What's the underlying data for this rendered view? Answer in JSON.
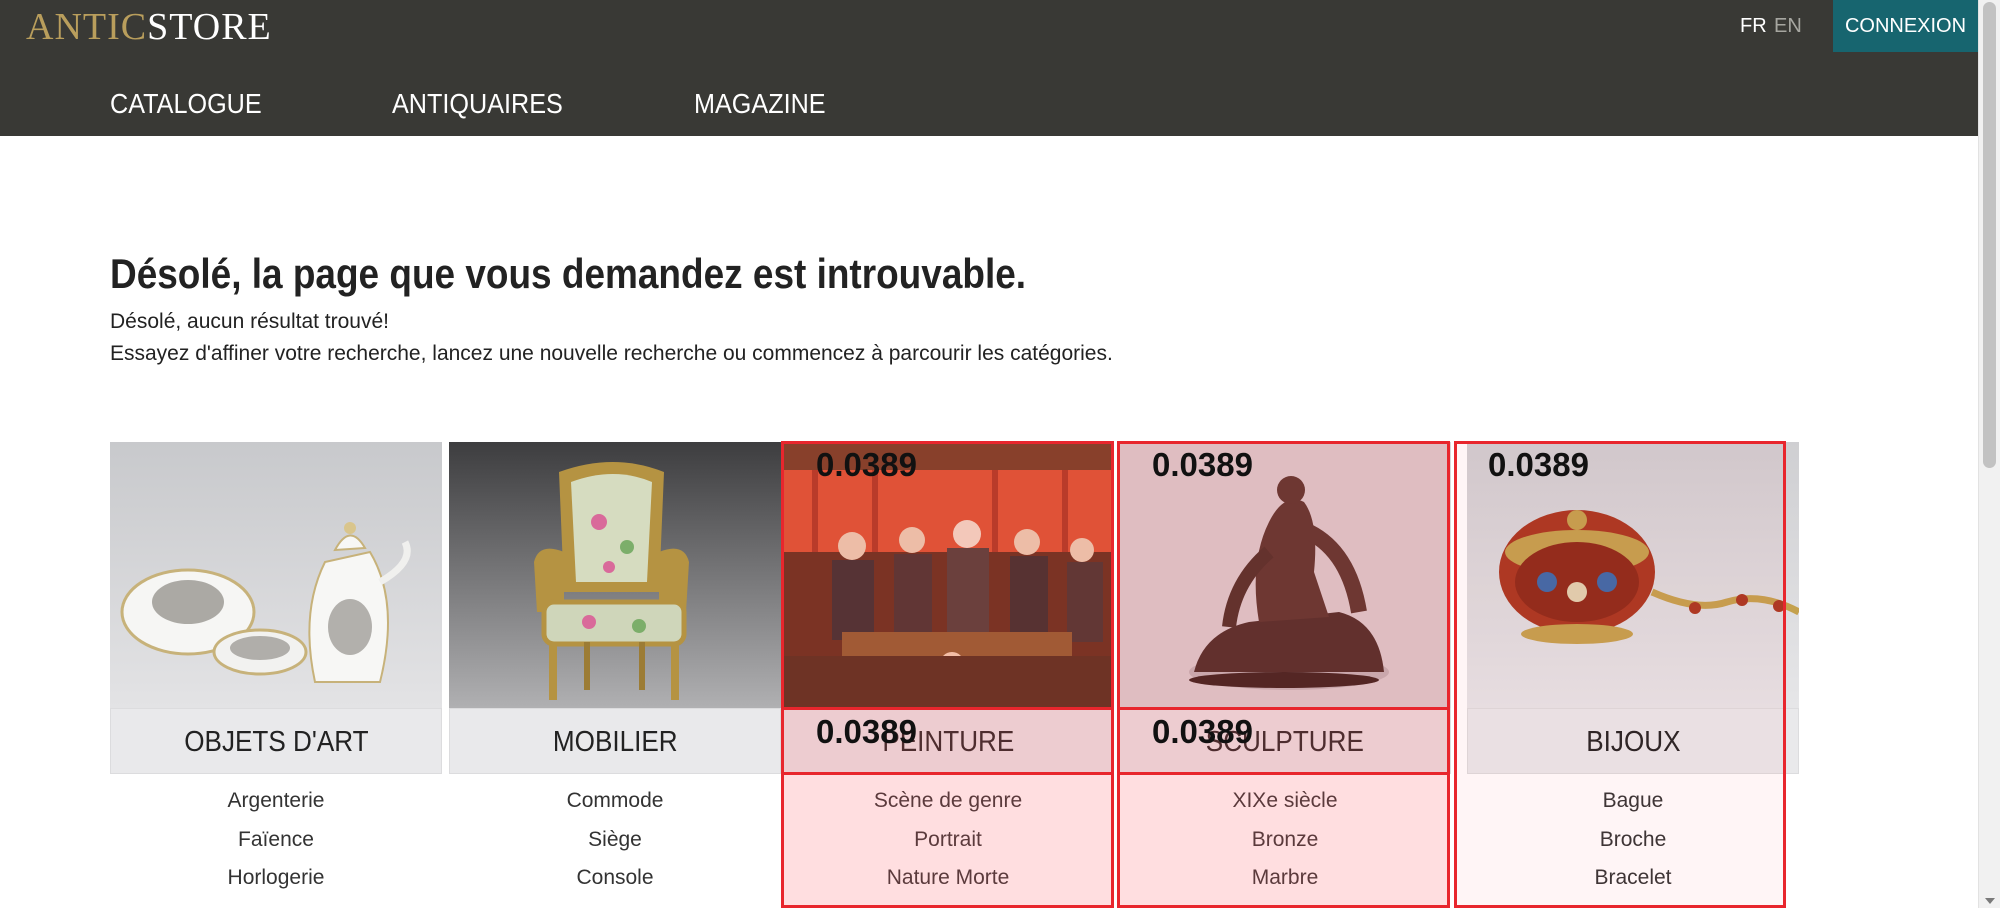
{
  "header": {
    "logo_part1": "ANTIC",
    "logo_part2": "STORE",
    "lang_fr": "FR",
    "lang_en": "EN",
    "login_label": "CONNEXION",
    "nav": [
      "CATALOGUE",
      "ANTIQUAIRES",
      "MAGAZINE"
    ]
  },
  "error": {
    "title": "Désolé, la page que vous demandez est introuvable.",
    "line1": "Désolé, aucun résultat trouvé!",
    "line2": "Essayez d'affiner votre recherche, lancez une nouvelle recherche ou commencez à parcourir les catégories."
  },
  "categories": [
    {
      "title": "OBJETS D'ART",
      "image_icon": "porcelain-tea-set-image",
      "links": [
        "Argenterie",
        "Faïence",
        "Horlogerie"
      ]
    },
    {
      "title": "MOBILIER",
      "image_icon": "armchair-image",
      "links": [
        "Commode",
        "Siège",
        "Console"
      ]
    },
    {
      "title": "PEINTURE",
      "image_icon": "genre-painting-image",
      "links": [
        "Scène de genre",
        "Portrait",
        "Nature Morte"
      ]
    },
    {
      "title": "SCULPTURE",
      "image_icon": "bronze-sculpture-image",
      "links": [
        "XIXe siècle",
        "Bronze",
        "Marbre"
      ]
    },
    {
      "title": "BIJOUX",
      "image_icon": "jewel-box-image",
      "links": [
        "Bague",
        "Broche",
        "Bracelet"
      ]
    }
  ],
  "overlays": {
    "scores": [
      "0.0389",
      "0.0389",
      "0.0389",
      "0.0389",
      "0.0389"
    ]
  },
  "colors": {
    "header_bg": "#393935",
    "logo_gold": "#b99e5c",
    "login_bg": "#17656f",
    "overlay_red": "#e8262d"
  }
}
